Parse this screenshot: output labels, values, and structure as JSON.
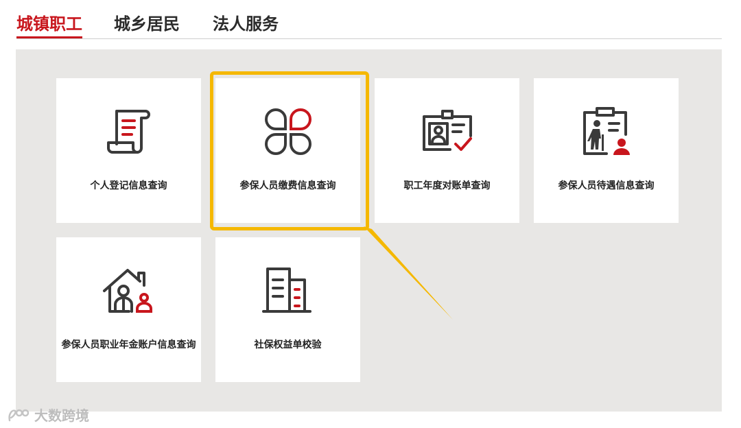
{
  "tabs": [
    {
      "label": "城镇职工",
      "active": true
    },
    {
      "label": "城乡居民",
      "active": false
    },
    {
      "label": "法人服务",
      "active": false
    }
  ],
  "cards": [
    {
      "label": "个人登记信息查询",
      "icon": "scroll-document-icon"
    },
    {
      "label": "参保人员缴费信息查询",
      "icon": "four-petal-icon"
    },
    {
      "label": "职工年度对账单查询",
      "icon": "id-card-check-icon"
    },
    {
      "label": "参保人员待遇信息查询",
      "icon": "clipboard-elder-icon"
    },
    {
      "label": "参保人员职业年金账户信息查询",
      "icon": "house-people-icon"
    },
    {
      "label": "社保权益单校验",
      "icon": "buildings-icon"
    }
  ],
  "watermark": "大数跨境",
  "colors": {
    "accent": "#c8161d",
    "highlight": "#f5b800",
    "icon_dark": "#3a3a3a",
    "panel_bg": "#e8e7e5"
  }
}
